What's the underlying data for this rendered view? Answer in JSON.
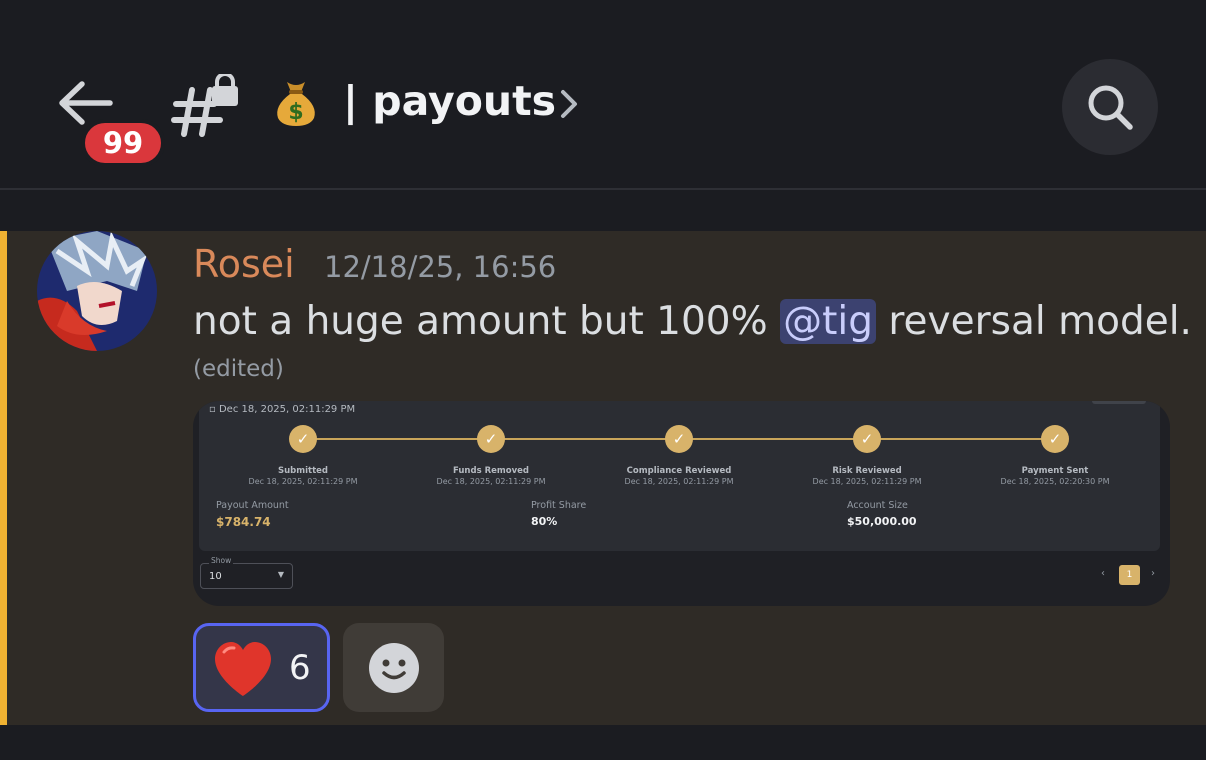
{
  "header": {
    "unread_badge": "99",
    "channel_name": "| payouts",
    "icons": [
      "back-arrow-icon",
      "locked-channel-icon",
      "money-bag-icon",
      "chevron-right-icon",
      "search-icon"
    ]
  },
  "message": {
    "username": "Rosei",
    "timestamp": "12/18/25, 16:56",
    "text_before": "not a huge amount but 100% ",
    "mention": "@tig",
    "text_after": " reversal model.",
    "edited": "(edited)",
    "accent_color": "#f0b232",
    "username_color": "#d9895a"
  },
  "attachment": {
    "date": "Dec 18, 2025, 02:11:29 PM",
    "steps": [
      {
        "label": "Submitted",
        "date": "Dec 18, 2025, 02:11:29 PM"
      },
      {
        "label": "Funds Removed",
        "date": "Dec 18, 2025, 02:11:29 PM"
      },
      {
        "label": "Compliance Reviewed",
        "date": "Dec 18, 2025, 02:11:29 PM"
      },
      {
        "label": "Risk Reviewed",
        "date": "Dec 18, 2025, 02:11:29 PM"
      },
      {
        "label": "Payment Sent",
        "date": "Dec 18, 2025, 02:20:30 PM"
      }
    ],
    "stats": [
      {
        "label": "Payout Amount",
        "value": "$784.74"
      },
      {
        "label": "Profit Share",
        "value": "80%"
      },
      {
        "label": "Account Size",
        "value": "$50,000.00"
      }
    ],
    "show_label": "Show",
    "show_value": "10",
    "page": "1",
    "prev": "‹",
    "next": "›"
  },
  "reactions": {
    "heart_count": "6",
    "heart_icon": "red-heart-icon",
    "add_icon": "add-reaction-smiley-icon"
  }
}
